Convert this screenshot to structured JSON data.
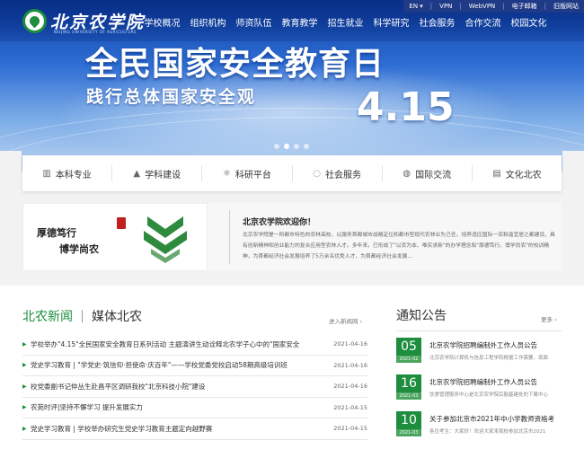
{
  "util": {
    "lang": "EN ▾",
    "vpn": "VPN",
    "webvpn": "WebVPN",
    "mail": "电子邮箱",
    "old_site": "旧版网站"
  },
  "logo": {
    "name": "北京农学院",
    "sub": "BEIJING UNIVERSITY OF AGRICULTURE"
  },
  "nav": [
    "学校概况",
    "组织机构",
    "师资队伍",
    "教育教学",
    "招生就业",
    "科学研究",
    "社会服务",
    "合作交流",
    "校园文化"
  ],
  "banner": {
    "title": "全民国家安全教育日",
    "subtitle": "践行总体国家安全观",
    "date": "4.15",
    "slides": 4,
    "active_slide": 2
  },
  "quick_menu": [
    {
      "icon": "book-icon",
      "glyph": "▥",
      "label": "本科专业"
    },
    {
      "icon": "graduation-cap-icon",
      "glyph": "🎓",
      "label": "学科建设"
    },
    {
      "icon": "atom-icon",
      "glyph": "⚛",
      "label": "科研平台"
    },
    {
      "icon": "chat-icon",
      "glyph": "◌",
      "label": "社会服务"
    },
    {
      "icon": "globe-icon",
      "glyph": "◍",
      "label": "国际交流"
    },
    {
      "icon": "document-icon",
      "glyph": "▤",
      "label": "文化北农"
    }
  ],
  "intro": {
    "motto_line1": "厚德笃行",
    "motto_line2": "博学尚农",
    "seal": "校训",
    "title": "北京农学院欢迎你！",
    "body": "北京农学院是一所都市特色的农林高校，以服务首都城市战略定位和都市型现代农林业为己任，培养适应国际一流和谐宜居之都建设、具有创新精神和创业能力的复合应用型农林人才。多年来，已形成了\"以农为本、唯实求新\"的办学理念和\"厚德笃行、博学尚农\"的校训精神，为首都经济社会发展培养了5万余名优秀人才，为首都经济社会发展..."
  },
  "news": {
    "tab_active": "北农新闻",
    "tab_other": "媒体北农",
    "more": "进入新闻网 ›",
    "items": [
      {
        "title": "学校举办\"4.15\"全民国家安全教育日系列活动 主题演讲生动诠释北农学子心中的\"国家安全",
        "date": "2021-04-16"
      },
      {
        "title": "党史学习教育 | \"学党史·筑信仰·担使命·庆百年\"——学校党委党校启动58期高级培训班",
        "date": "2021-04-16"
      },
      {
        "title": "校党委副书记仲丛生赴昌平区调研我校\"北京科技小院\"建设",
        "date": "2021-04-16"
      },
      {
        "title": "农苑时评|坚持不懈学习 提升发展实力",
        "date": "2021-04-15"
      },
      {
        "title": "党史学习教育 | 学校举办研究生党史学习教育主题定向越野赛",
        "date": "2021-04-15"
      }
    ]
  },
  "notice": {
    "title": "通知公告",
    "more": "更多 ›",
    "items": [
      {
        "day": "05",
        "ym": "2021-02",
        "title": "北京农学院招聘编制外工作人员公告",
        "desc": "北京农学院计算机与信息工程学院根据工作需要，现面"
      },
      {
        "day": "16",
        "ym": "2021-03",
        "title": "北京农学院招聘编制外工作人员公告",
        "desc": "饮食管理服务中心是北京农学院后勤基建处的下属中心"
      },
      {
        "day": "10",
        "ym": "2021-03",
        "title": "关于参加北京市2021年中小学教师资格考",
        "desc": "各位考生：大家好！欢迎大家来我校参加北京市2021"
      }
    ]
  }
}
